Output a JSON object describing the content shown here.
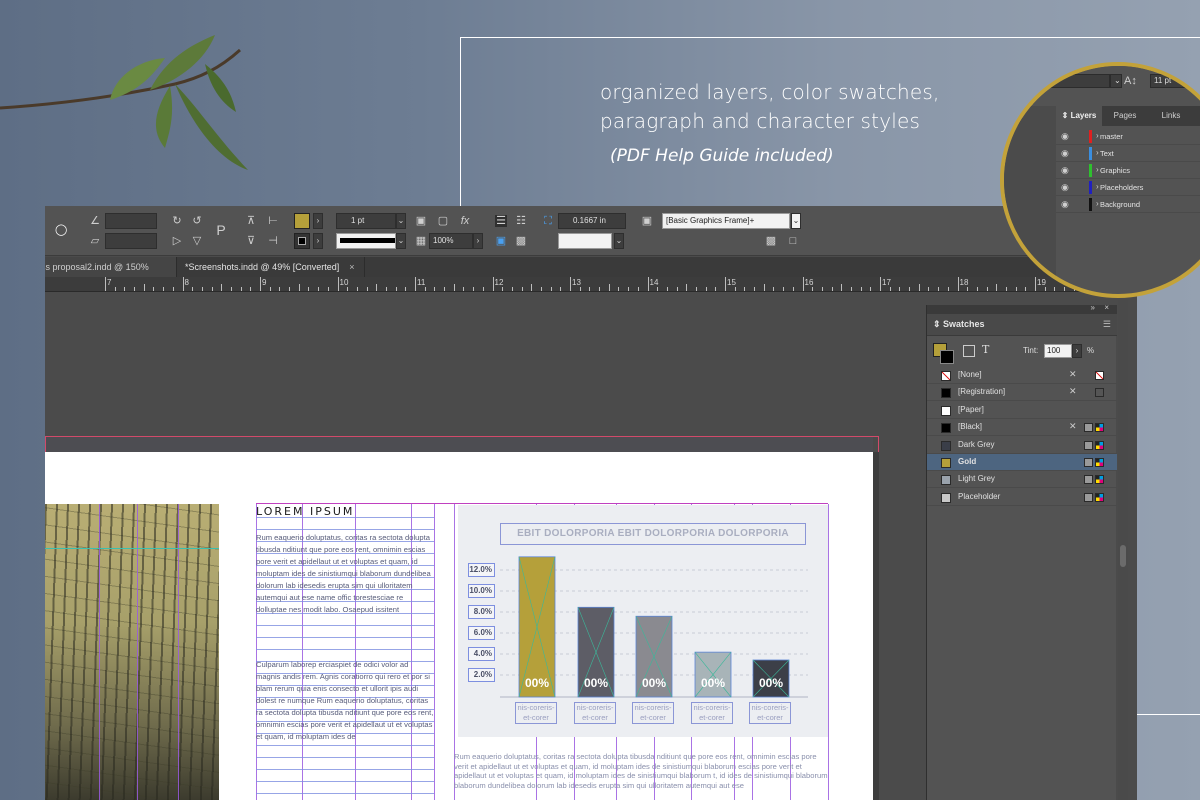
{
  "hero": {
    "line1": "organized layers, color swatches,",
    "line2": "paragraph and character styles",
    "subline": "(PDF Help Guide included)"
  },
  "control_bar": {
    "stroke_weight": "1 pt",
    "opacity": "100%",
    "offset": "0.1667 in",
    "object_style": "[Basic Graphics Frame]+",
    "fill_color": "#b5a03a",
    "stroke_color": "#000000"
  },
  "tabs": [
    {
      "label": "ss proposal2.indd @ 150%",
      "close": "×"
    },
    {
      "label": "*Screenshots.indd @ 49% [Converted]",
      "close": "×"
    }
  ],
  "ruler": {
    "labels": [
      "7",
      "8",
      "9",
      "10",
      "11",
      "12",
      "13",
      "14",
      "15",
      "16",
      "17",
      "18",
      "19"
    ]
  },
  "document": {
    "heading": "LOREM IPSUM",
    "paragraph1": "Rum eaquerio doluptatus, coritas ra sectota dolupta tibusda nditiunt que pore eos rent, omnimin escias pore verit et apidellaut ut et voluptas et quam, id moluptam ides de sinistiumqui blaborum dundelibea dolorum lab idesedis erupta sim qui ulloritatem autemqui aut ese name offic torestesciae re dolluptae nes modit labo. Osaepud issitent",
    "paragraph2": "Culparum laborep erciaspiet de odici volor ad magnis andis rem. Agnis coratiorro qui rero et por si blam rerum quia enis consecto et ullorit ipis audi dolest re numque Rum eaquerio doluptatus, coritas ra sectota dolupta tibusda nditiunt que pore eos rent, omnimin escias pore verit et apidellaut ut et voluptas et quam, id moluptam ides de",
    "bottom_paragraph": "Rum eaquerio doluptatus, coritas ra sectota dolupta tibusda nditiunt que pore eos rent, omnimin escias pore verit et apidellaut ut et voluptas et quam, id moluptam ides de sinistiumqui blaborum escias pore verit et apidellaut ut et voluptas et quam, id moluptam ides de sinistiumqui blaborum t, id ides de sinistiumqui blaborum blaborum dundelibea dolorum lab idesedis erupta sim qui ulloritatem autemqui aut ese"
  },
  "chart_data": {
    "type": "bar",
    "title": "EBIT DOLORPORIA EBIT DOLORPORIA DOLORPORIA",
    "y_ticks": [
      "12.0%",
      "10.0%",
      "8.0%",
      "6.0%",
      "4.0%",
      "2.0%"
    ],
    "categories": [
      "nis-coreris-et-corer",
      "nis-coreris-et-corer",
      "nis-coreris-et-corer",
      "nis-coreris-et-corer",
      "nis-coreris-et-corer"
    ],
    "values": [
      12.5,
      8.0,
      7.2,
      4.0,
      3.3
    ],
    "bar_labels": [
      "00%",
      "00%",
      "00%",
      "00%",
      "00%"
    ],
    "bar_colors": [
      "#b5a03a",
      "#5d5d66",
      "#8a8a90",
      "#a8b4b8",
      "#3c3f48"
    ],
    "ylim": [
      0,
      14
    ]
  },
  "swatches_panel": {
    "title": "Swatches",
    "tint_label": "Tint:",
    "tint_value": "100",
    "tint_unit": "%",
    "swatches": [
      {
        "name": "[None]",
        "color": "#ffffff"
      },
      {
        "name": "[Registration]",
        "color": "#000000"
      },
      {
        "name": "[Paper]",
        "color": "#ffffff"
      },
      {
        "name": "[Black]",
        "color": "#000000"
      },
      {
        "name": "Dark Grey",
        "color": "#3a3e48"
      },
      {
        "name": "Gold",
        "color": "#b5a03a"
      },
      {
        "name": "Light Grey",
        "color": "#9aa3ad"
      },
      {
        "name": "Placeholder",
        "color": "#c9c9c9"
      }
    ],
    "selected": "Gold"
  },
  "layers_panel": {
    "tabs": [
      "Layers",
      "Pages",
      "Links"
    ],
    "zoom_field": "11 pt",
    "layers": [
      {
        "name": "master",
        "color": "#e02020"
      },
      {
        "name": "Text",
        "color": "#3a8ee0"
      },
      {
        "name": "Graphics",
        "color": "#2ec02e"
      },
      {
        "name": "Placeholders",
        "color": "#2020c0"
      },
      {
        "name": "Background",
        "color": "#111111"
      }
    ]
  }
}
